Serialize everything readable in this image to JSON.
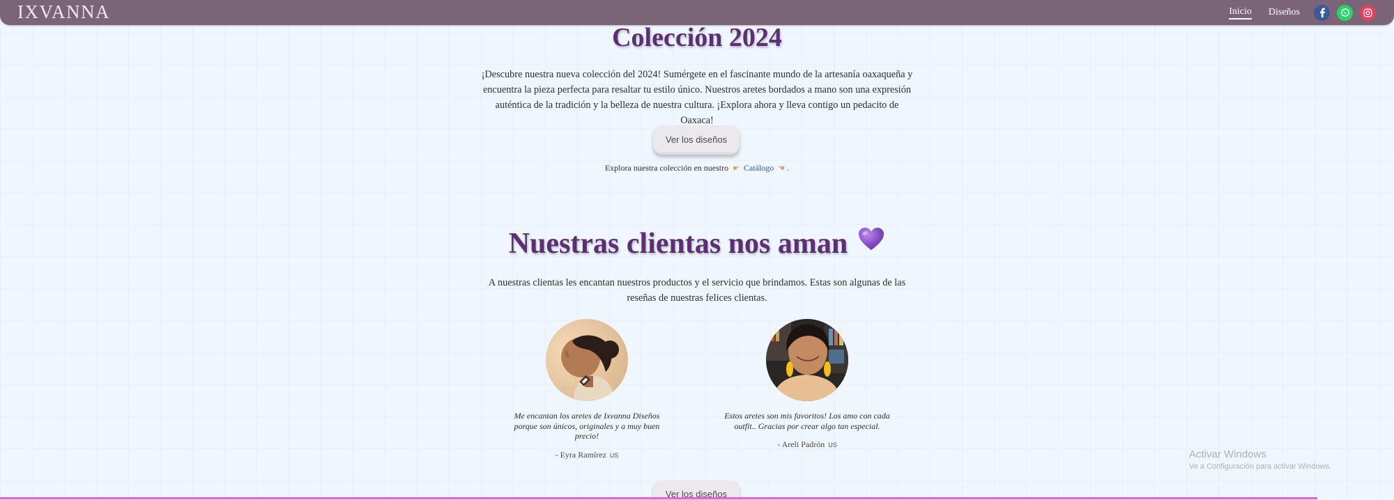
{
  "navbar": {
    "brand": "IXVANNA",
    "links": [
      {
        "label": "Inicio",
        "active": true
      },
      {
        "label": "Diseños",
        "active": false
      }
    ],
    "social": [
      {
        "icon": "facebook-icon",
        "color": "#3b5998"
      },
      {
        "icon": "whatsapp-icon",
        "color": "#25d366"
      },
      {
        "icon": "instagram-icon",
        "color": "#e4405f"
      }
    ]
  },
  "hero": {
    "title": "Colección 2024",
    "text": "¡Descubre nuestra nueva colección del 2024! Sumérgete en el fascinante mundo de la artesanía oaxaqueña y encuentra la pieza perfecta para resaltar tu estilo único. Nuestros aretes bordados a mano son una expresión auténtica de la tradición y la belleza de nuestra cultura. ¡Explora ahora y lleva contigo un pedacito de Oaxaca!",
    "button_label": "Ver los diseños",
    "catalog_prefix": "Explora nuestra colección en nuestro",
    "catalog_link": "Catálogo",
    "catalog_suffix": "."
  },
  "testimonials": {
    "title": "Nuestras clientas nos aman",
    "text": "A nuestras clientas les encantan nuestros productos y el servicio que brindamos. Estas son algunas de las reseñas de nuestras felices clientas.",
    "reviews": [
      {
        "quote": "Me encantan los aretes de Ixvanna Diseños porque son únicos, originales y a muy buen precio!",
        "author": "- Eyra Ramírez",
        "flag": "US"
      },
      {
        "quote": "Estos aretes son mis favoritos! Los amo con cada outfit.. Gracias por crear algo tan especial.",
        "author": "- Areli Padrón",
        "flag": "US"
      }
    ],
    "button_label": "Ver los diseños"
  },
  "watermark": {
    "title": "Activar Windows",
    "subtitle": "Ve a Configuración para activar Windows."
  },
  "colors": {
    "navbar": "#7b6378",
    "title": "#5b2f72",
    "link": "#3a52b4",
    "accent_line": "#e85ce0"
  }
}
